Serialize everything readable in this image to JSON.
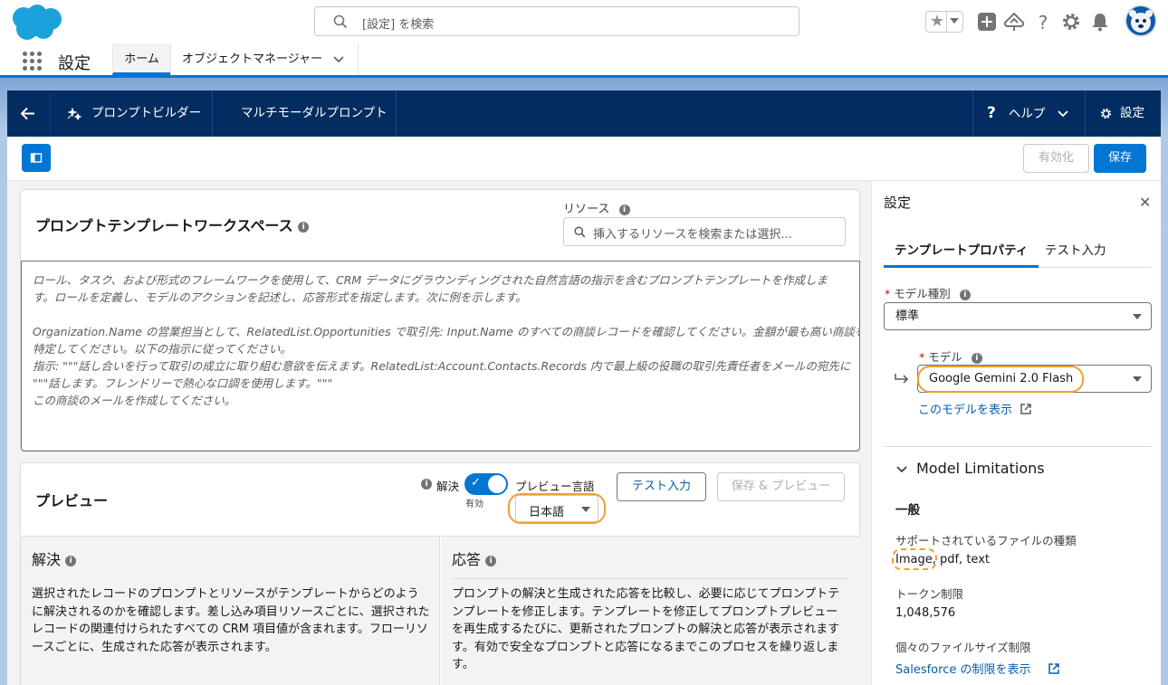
{
  "global": {
    "search_placeholder": "[設定] を検索"
  },
  "nav": {
    "app_name": "設定",
    "tab_home": "ホーム",
    "tab_object_manager": "オブジェクトマネージャー"
  },
  "builder": {
    "prompt_builder": "プロンプトビルダー",
    "multimodal": "マルチモーダルプロンプト",
    "help": "ヘルプ",
    "settings": "設定"
  },
  "toolbar": {
    "activate_label": "有効化",
    "save_label": "保存"
  },
  "workspace": {
    "title": "プロンプトテンプレートワークスペース",
    "resource_label": "リソース",
    "resource_placeholder": "挿入するリソースを検索または選択...",
    "template_lines": [
      "ロール、タスク、および形式のフレームワークを使用して、CRM データにグラウンディングされた自然言語の指示を含むプロンプトテンプレートを作成しま",
      "す。ロールを定義し、モデルのアクションを記述し、応答形式を指定します。次に例を示します。",
      "",
      "Organization.Name の営業担当として、RelatedList.Opportunities で取引先: Input.Name のすべての商談レコードを確認してください。金額が最も高い商談を",
      "特定してください。以下の指示に従ってください。",
      "指示: \"\"\"話し合いを行って取引の成立に取り組む意欲を伝えます。RelatedList:Account.Contacts.Records 内で最上級の役職の取引先責任者をメールの宛先に",
      "\"\"\"話します。フレンドリーで熱心な口調を使用します。\"\"\"",
      "この商談のメールを作成してください。"
    ]
  },
  "preview": {
    "title": "プレビュー",
    "resolve_label": "解決",
    "toggle_state": "有効",
    "language_label": "プレビュー言語",
    "language_value": "日本語",
    "test_input_button": "テスト入力",
    "save_preview_button": "保存 & プレビュー",
    "resolve_panel": {
      "title": "解決",
      "text_lines": [
        "選択されたレコードのプロンプトとリソースがテンプレートからどのよう",
        "に解決されるのかを確認します。差し込み項目リソースごとに、選択された",
        "レコードの関連付けられたすべての CRM 項目値が含まれます。フローリソ",
        "ースごとに、生成された応答が表示されます。"
      ]
    },
    "response_panel": {
      "title": "応答",
      "text_lines": [
        "プロンプトの解決と生成された応答を比較し、必要に応じてプロンプトテ",
        "ンプレートを修正します。テンプレートを修正してプロンプトプレビュー",
        "を再生成するたびに、更新されたプロンプトの解決と応答が表示されます",
        "す。有効で安全なプロンプトと応答になるまでこのプロセスを繰り返しま",
        "す。"
      ]
    }
  },
  "settings_panel": {
    "title": "設定",
    "tab_properties": "テンプレートプロパティ",
    "tab_test_input": "テスト入力",
    "model_type_label": "モデル種別",
    "model_type_value": "標準",
    "model_label": "モデル",
    "model_value": "Google Gemini 2.0 Flash",
    "view_model_link": "このモデルを表示",
    "limitations_heading": "Model Limitations",
    "general_heading": "一般",
    "file_types_label": "サポートされているファイルの種類",
    "file_types_value": "Image, pdf, text",
    "token_limit_label": "トークン制限",
    "token_limit_value": "1,048,576",
    "file_size_label": "個々のファイルサイズ制限",
    "limits_link": "Salesforce の制限を表示"
  },
  "colors": {
    "brand": "#0176d3",
    "navy": "#032d60",
    "highlight": "#f0a030"
  }
}
